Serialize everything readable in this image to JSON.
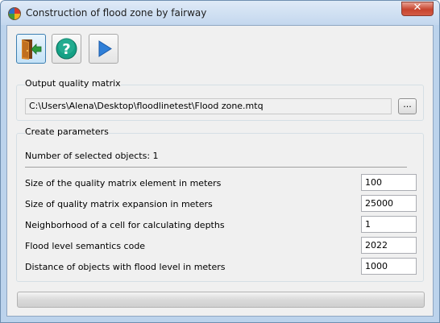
{
  "window": {
    "title": "Construction of flood zone by fairway",
    "close_label": "✕"
  },
  "toolbar": {
    "buttons": [
      {
        "icon": "exit-door-icon"
      },
      {
        "icon": "help-icon",
        "glyph": "?"
      },
      {
        "icon": "play-icon"
      }
    ]
  },
  "output": {
    "group_title": "Output quality matrix",
    "path": "C:\\Users\\Alena\\Desktop\\floodlinetest\\Flood zone.mtq",
    "browse_label": "..."
  },
  "params": {
    "group_title": "Create parameters",
    "selected_text": "Number of selected objects: 1",
    "rows": [
      {
        "label": "Size of the quality matrix element in meters",
        "value": "100"
      },
      {
        "label": "Size of quality matrix expansion in meters",
        "value": "25000"
      },
      {
        "label": "Neighborhood of a cell for calculating depths",
        "value": "1"
      },
      {
        "label": "Flood level semantics code",
        "value": "2022"
      },
      {
        "label": "Distance of objects with flood level in meters",
        "value": "1000"
      }
    ]
  },
  "progress": {
    "value": 0
  },
  "colors": {
    "help_green": "#14a085",
    "play_blue": "#2f7fd8",
    "exit_green": "#2e9b3c",
    "door_brown": "#b0682a"
  }
}
